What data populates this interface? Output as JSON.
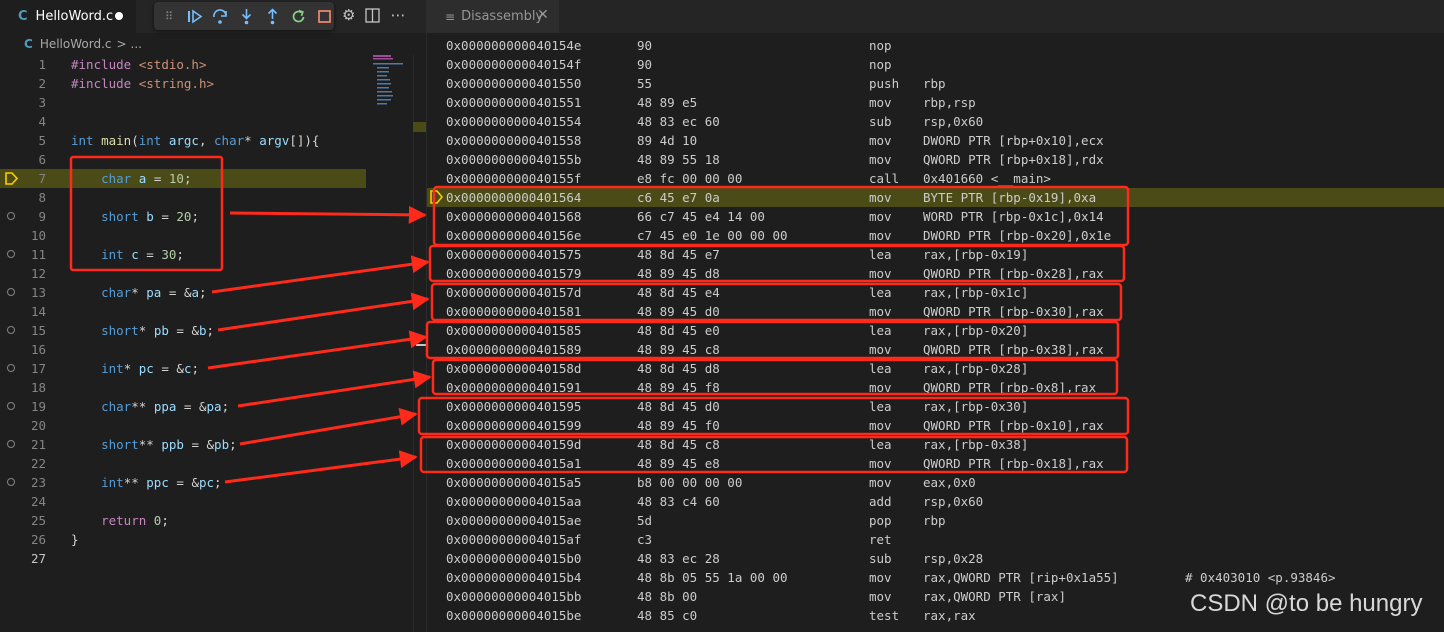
{
  "editor": {
    "tab": {
      "filename": "HelloWord.c",
      "lang_icon": "C",
      "dirty": true
    },
    "breadcrumb": {
      "file": "HelloWord.c",
      "sep": ">",
      "tail": "..."
    },
    "toolbar": {
      "icons": [
        "grip-icon",
        "continue-icon",
        "step-over-icon",
        "step-into-icon",
        "step-out-icon",
        "restart-icon",
        "stop-icon"
      ]
    },
    "actions": [
      "gear-icon",
      "split-editor-icon",
      "more-actions-icon"
    ],
    "lines": [
      {
        "n": "1",
        "code": "#include <stdio.h>"
      },
      {
        "n": "2",
        "code": "#include <string.h>"
      },
      {
        "n": "3",
        "code": ""
      },
      {
        "n": "4",
        "code": ""
      },
      {
        "n": "5",
        "code": "int main(int argc, char* argv[]){"
      },
      {
        "n": "6",
        "code": ""
      },
      {
        "n": "7",
        "code": "    char a = 10;"
      },
      {
        "n": "8",
        "code": ""
      },
      {
        "n": "9",
        "code": "    short b = 20;"
      },
      {
        "n": "10",
        "code": ""
      },
      {
        "n": "11",
        "code": "    int c = 30;"
      },
      {
        "n": "12",
        "code": ""
      },
      {
        "n": "13",
        "code": "    char* pa = &a;"
      },
      {
        "n": "14",
        "code": ""
      },
      {
        "n": "15",
        "code": "    short* pb = &b;"
      },
      {
        "n": "16",
        "code": ""
      },
      {
        "n": "17",
        "code": "    int* pc = &c;"
      },
      {
        "n": "18",
        "code": ""
      },
      {
        "n": "19",
        "code": "    char** ppa = &pa;"
      },
      {
        "n": "20",
        "code": ""
      },
      {
        "n": "21",
        "code": "    short** ppb = &pb;"
      },
      {
        "n": "22",
        "code": ""
      },
      {
        "n": "23",
        "code": "    int** ppc = &pc;"
      },
      {
        "n": "24",
        "code": ""
      },
      {
        "n": "25",
        "code": "    return 0;"
      },
      {
        "n": "26",
        "code": "}"
      },
      {
        "n": "27",
        "code": ""
      }
    ]
  },
  "disassembly": {
    "tab_title": "Disassembly",
    "rows": [
      {
        "addr": "0x000000000040154e",
        "bytes": "90",
        "op": "nop",
        "args": "",
        "comment": ""
      },
      {
        "addr": "0x000000000040154f",
        "bytes": "90",
        "op": "nop",
        "args": "",
        "comment": ""
      },
      {
        "addr": "0x0000000000401550",
        "bytes": "55",
        "op": "push",
        "args": "rbp",
        "comment": ""
      },
      {
        "addr": "0x0000000000401551",
        "bytes": "48 89 e5",
        "op": "mov",
        "args": "rbp,rsp",
        "comment": ""
      },
      {
        "addr": "0x0000000000401554",
        "bytes": "48 83 ec 60",
        "op": "sub",
        "args": "rsp,0x60",
        "comment": ""
      },
      {
        "addr": "0x0000000000401558",
        "bytes": "89 4d 10",
        "op": "mov",
        "args": "DWORD PTR [rbp+0x10],ecx",
        "comment": ""
      },
      {
        "addr": "0x000000000040155b",
        "bytes": "48 89 55 18",
        "op": "mov",
        "args": "QWORD PTR [rbp+0x18],rdx",
        "comment": ""
      },
      {
        "addr": "0x000000000040155f",
        "bytes": "e8 fc 00 00 00",
        "op": "call",
        "args": "0x401660 <__main>",
        "comment": ""
      },
      {
        "addr": "0x0000000000401564",
        "bytes": "c6 45 e7 0a",
        "op": "mov",
        "args": "BYTE PTR [rbp-0x19],0xa",
        "comment": ""
      },
      {
        "addr": "0x0000000000401568",
        "bytes": "66 c7 45 e4 14 00",
        "op": "mov",
        "args": "WORD PTR [rbp-0x1c],0x14",
        "comment": ""
      },
      {
        "addr": "0x000000000040156e",
        "bytes": "c7 45 e0 1e 00 00 00",
        "op": "mov",
        "args": "DWORD PTR [rbp-0x20],0x1e",
        "comment": ""
      },
      {
        "addr": "0x0000000000401575",
        "bytes": "48 8d 45 e7",
        "op": "lea",
        "args": "rax,[rbp-0x19]",
        "comment": ""
      },
      {
        "addr": "0x0000000000401579",
        "bytes": "48 89 45 d8",
        "op": "mov",
        "args": "QWORD PTR [rbp-0x28],rax",
        "comment": ""
      },
      {
        "addr": "0x000000000040157d",
        "bytes": "48 8d 45 e4",
        "op": "lea",
        "args": "rax,[rbp-0x1c]",
        "comment": ""
      },
      {
        "addr": "0x0000000000401581",
        "bytes": "48 89 45 d0",
        "op": "mov",
        "args": "QWORD PTR [rbp-0x30],rax",
        "comment": ""
      },
      {
        "addr": "0x0000000000401585",
        "bytes": "48 8d 45 e0",
        "op": "lea",
        "args": "rax,[rbp-0x20]",
        "comment": ""
      },
      {
        "addr": "0x0000000000401589",
        "bytes": "48 89 45 c8",
        "op": "mov",
        "args": "QWORD PTR [rbp-0x38],rax",
        "comment": ""
      },
      {
        "addr": "0x000000000040158d",
        "bytes": "48 8d 45 d8",
        "op": "lea",
        "args": "rax,[rbp-0x28]",
        "comment": ""
      },
      {
        "addr": "0x0000000000401591",
        "bytes": "48 89 45 f8",
        "op": "mov",
        "args": "QWORD PTR [rbp-0x8],rax",
        "comment": ""
      },
      {
        "addr": "0x0000000000401595",
        "bytes": "48 8d 45 d0",
        "op": "lea",
        "args": "rax,[rbp-0x30]",
        "comment": ""
      },
      {
        "addr": "0x0000000000401599",
        "bytes": "48 89 45 f0",
        "op": "mov",
        "args": "QWORD PTR [rbp-0x10],rax",
        "comment": ""
      },
      {
        "addr": "0x000000000040159d",
        "bytes": "48 8d 45 c8",
        "op": "lea",
        "args": "rax,[rbp-0x38]",
        "comment": ""
      },
      {
        "addr": "0x00000000004015a1",
        "bytes": "48 89 45 e8",
        "op": "mov",
        "args": "QWORD PTR [rbp-0x18],rax",
        "comment": ""
      },
      {
        "addr": "0x00000000004015a5",
        "bytes": "b8 00 00 00 00",
        "op": "mov",
        "args": "eax,0x0",
        "comment": ""
      },
      {
        "addr": "0x00000000004015aa",
        "bytes": "48 83 c4 60",
        "op": "add",
        "args": "rsp,0x60",
        "comment": ""
      },
      {
        "addr": "0x00000000004015ae",
        "bytes": "5d",
        "op": "pop",
        "args": "rbp",
        "comment": ""
      },
      {
        "addr": "0x00000000004015af",
        "bytes": "c3",
        "op": "ret",
        "args": "",
        "comment": ""
      },
      {
        "addr": "0x00000000004015b0",
        "bytes": "48 83 ec 28",
        "op": "sub",
        "args": "rsp,0x28",
        "comment": ""
      },
      {
        "addr": "0x00000000004015b4",
        "bytes": "48 8b 05 55 1a 00 00",
        "op": "mov",
        "args": "rax,QWORD PTR [rip+0x1a55]",
        "comment": "# 0x403010 <p.93846>"
      },
      {
        "addr": "0x00000000004015bb",
        "bytes": "48 8b 00",
        "op": "mov",
        "args": "rax,QWORD PTR [rax]",
        "comment": ""
      },
      {
        "addr": "0x00000000004015be",
        "bytes": "48 85 c0",
        "op": "test",
        "args": "rax,rax",
        "comment": ""
      }
    ]
  },
  "watermark": "CSDN @to be hungry",
  "colors": {
    "annotation": "#ff2a1a",
    "current_line": "#4b4b18",
    "arrow_marker": "#ffcc00"
  }
}
